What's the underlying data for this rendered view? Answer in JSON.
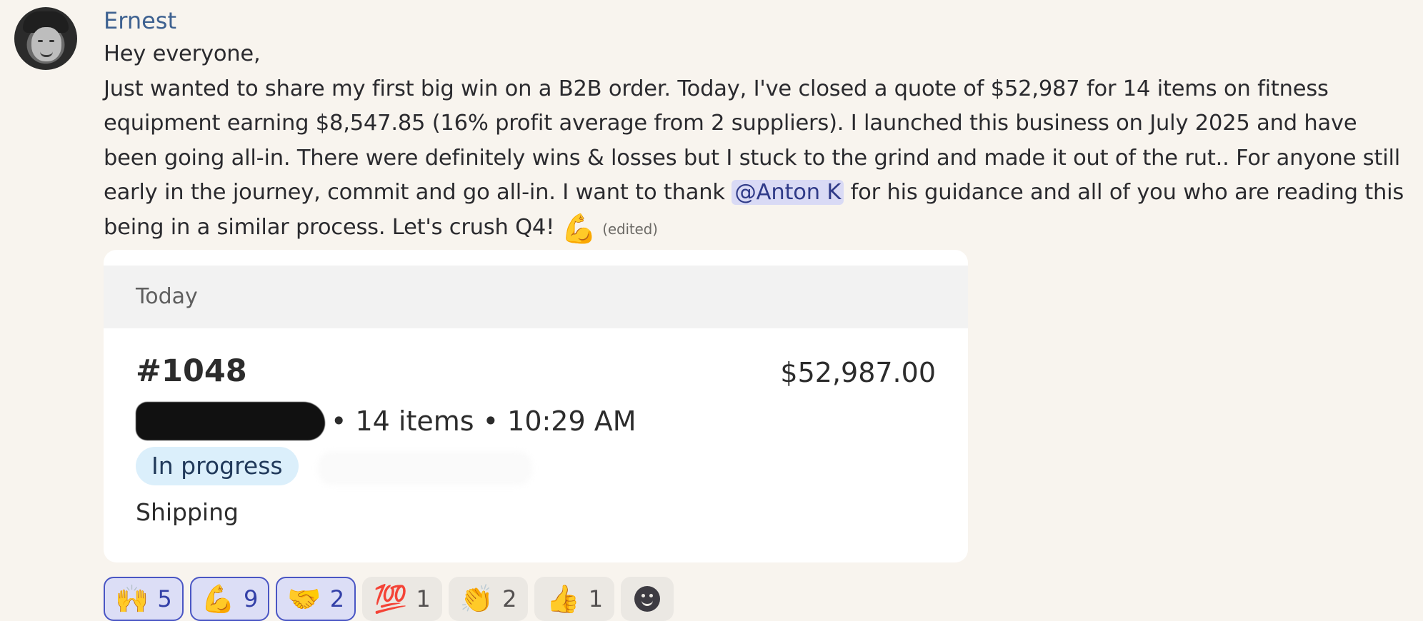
{
  "message": {
    "author": "Ernest",
    "greeting": "Hey everyone,",
    "text_before_mention": "Just wanted to share my first big win on a B2B order. Today, I've closed a quote of $52,987 for 14 items on fitness equipment earning $8,547.85 (16% profit average from 2 suppliers). I launched this business on July 2025 and have been going all-in. There were definitely wins & losses but I stuck to the grind and made it out of the rut.. For anyone still early in the journey, commit and go all-in. I want to thank ",
    "mention": "@Anton K",
    "text_after_mention": " for his guidance and all of you who are reading this being in a similar process. Let's crush Q4! ",
    "emoji": "💪",
    "edited_label": "(edited)"
  },
  "order_card": {
    "header_label": "Today",
    "order_number": "#1048",
    "total": "$52,987.00",
    "meta": "• 14 items • 10:29 AM",
    "status": "In progress",
    "fulfillment": "Shipping"
  },
  "reactions": [
    {
      "emoji": "🙌",
      "count": "5",
      "selected": true
    },
    {
      "emoji": "💪",
      "count": "9",
      "selected": true
    },
    {
      "emoji": "🤝",
      "count": "2",
      "selected": true
    },
    {
      "emoji": "💯",
      "count": "1",
      "selected": false
    },
    {
      "emoji": "👏",
      "count": "2",
      "selected": false
    },
    {
      "emoji": "👍",
      "count": "1",
      "selected": false
    }
  ],
  "colors": {
    "background": "#f8f4ee",
    "username": "#3e6190",
    "mention_bg": "#d9daf5",
    "status_badge_bg": "#dbeffb",
    "reaction_selected_border": "#4a56c4"
  },
  "icons": {
    "add_reaction": "smiley-icon"
  }
}
